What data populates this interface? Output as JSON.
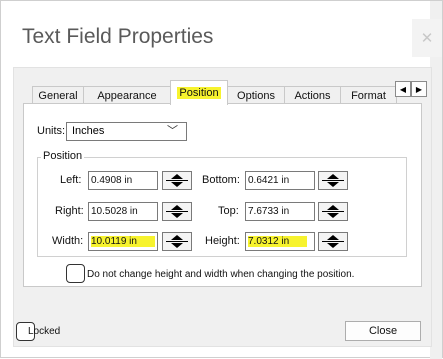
{
  "window": {
    "title": "Text Field Properties",
    "close_glyph": "✕"
  },
  "tabs": [
    {
      "label": "General"
    },
    {
      "label": "Appearance"
    },
    {
      "label": "Position",
      "active": true
    },
    {
      "label": "Options"
    },
    {
      "label": "Actions"
    },
    {
      "label": "Format"
    }
  ],
  "tab_scroll": {
    "left": "◀",
    "right": "▶"
  },
  "units": {
    "label": "Units:",
    "value": "Inches"
  },
  "position": {
    "title": "Position",
    "left": {
      "label": "Left:",
      "value": "0.4908 in"
    },
    "bottom": {
      "label": "Bottom:",
      "value": "0.6421 in"
    },
    "right": {
      "label": "Right:",
      "value": "10.5028 in"
    },
    "top": {
      "label": "Top:",
      "value": "7.6733 in"
    },
    "width": {
      "label": "Width:",
      "value": "10.0119 in"
    },
    "height": {
      "label": "Height:",
      "value": "7.0312 in"
    }
  },
  "keep_size": {
    "label": "Do not change height and width when changing the position."
  },
  "locked": {
    "label": "Locked"
  },
  "close_button": {
    "label": "Close"
  },
  "highlight_color": "#f7f32e"
}
